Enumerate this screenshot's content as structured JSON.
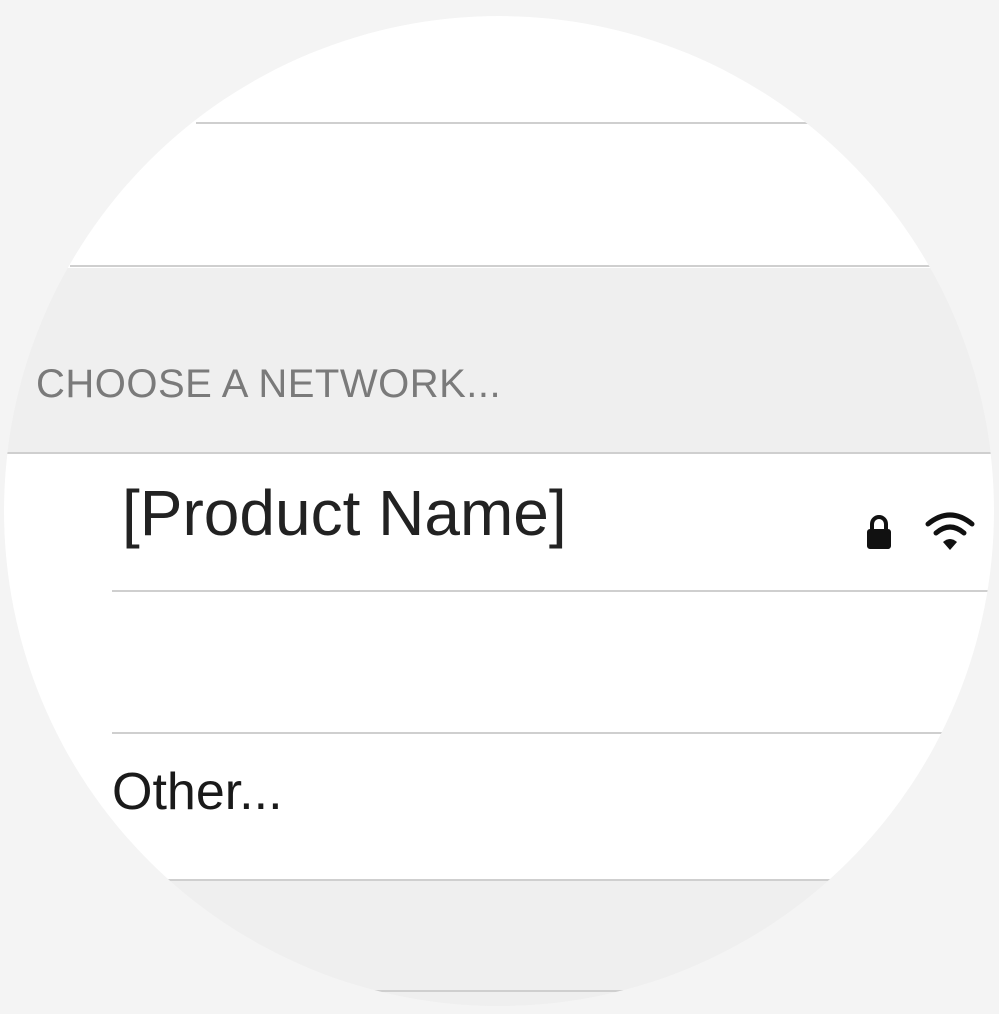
{
  "section": {
    "header": "CHOOSE A NETWORK..."
  },
  "networks": [
    {
      "name": "[Product Name]",
      "secured": true,
      "icons": [
        "lock-icon",
        "wifi-icon"
      ]
    }
  ],
  "other": {
    "label": "Other..."
  },
  "colors": {
    "background": "#f4f4f4",
    "row": "#ffffff",
    "section": "#efefef",
    "separator": "#cfcfcf",
    "header_text": "#7a7a7a",
    "primary_text": "#222222"
  }
}
